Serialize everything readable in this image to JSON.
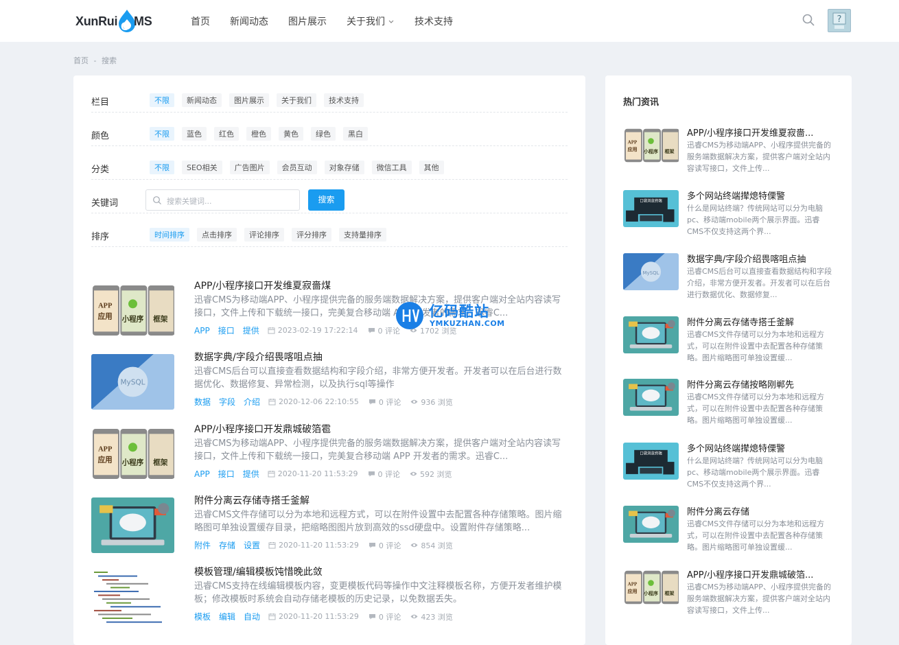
{
  "header": {
    "logo_text_left": "XunRui",
    "logo_text_right": "MS",
    "nav": [
      {
        "label": "首页"
      },
      {
        "label": "新闻动态"
      },
      {
        "label": "图片展示"
      },
      {
        "label": "关于我们",
        "has_dropdown": true
      },
      {
        "label": "技术支持"
      }
    ],
    "accent_color": "#1a9cf0"
  },
  "breadcrumb": {
    "home": "首页",
    "sep": "-",
    "current": "搜索"
  },
  "filters": {
    "column": {
      "label": "栏目",
      "options": [
        "不限",
        "新闻动态",
        "图片展示",
        "关于我们",
        "技术支持"
      ],
      "active": 0
    },
    "color": {
      "label": "颜色",
      "options": [
        "不限",
        "蓝色",
        "红色",
        "橙色",
        "黄色",
        "绿色",
        "黑白"
      ],
      "active": 0
    },
    "category": {
      "label": "分类",
      "options": [
        "不限",
        "SEO相关",
        "广告图片",
        "会员互动",
        "对象存储",
        "微信工具",
        "其他"
      ],
      "active": 0
    },
    "keyword": {
      "label": "关键词",
      "placeholder": "搜索关键词...",
      "button": "搜索"
    },
    "sort": {
      "label": "排序",
      "options": [
        "时间排序",
        "点击排序",
        "评论排序",
        "评分排序",
        "支持量排序"
      ],
      "active": 0
    }
  },
  "articles": [
    {
      "title": "APP/小程序接口开发维夏寂嗇煤",
      "desc": "迅睿CMS为移动端APP、小程序提供完备的服务端数据解决方案，提供客户端对全站内容读写接口，文件上传和下载统一接口，完美复合移动端 APP 开发者的需求。迅睿C...",
      "tags": [
        "APP",
        "接口",
        "提供"
      ],
      "date": "2023-02-19 17:22:14",
      "comments": "0 评论",
      "views": "1702 浏览",
      "thumb": "app"
    },
    {
      "title": "数据字典/字段介绍畏喀咀点抽",
      "desc": "迅睿CMS后台可以直接查看数据结构和字段介绍，非常方便开发者。开发者可以在后台进行数据优化、数据修复、异常检测，以及执行sql等操作",
      "tags": [
        "数据",
        "字段",
        "介绍"
      ],
      "date": "2020-12-06 22:10:55",
      "comments": "0 评论",
      "views": "936 浏览",
      "thumb": "mysql"
    },
    {
      "title": "APP/小程序接口开发鼎城破箔雹",
      "desc": "迅睿CMS为移动端APP、小程序提供完备的服务端数据解决方案，提供客户端对全站内容读写接口，文件上传和下载统一接口，完美复合移动端 APP 开发者的需求。迅睿C...",
      "tags": [
        "APP",
        "接口",
        "提供"
      ],
      "date": "2020-11-20 11:53:29",
      "comments": "0 评论",
      "views": "592 浏览",
      "thumb": "app"
    },
    {
      "title": "附件分离云存储寺搭壬釜解",
      "desc": "迅睿CMS文件存储可以分为本地和远程方式，可以在附件设置中去配置各种存储策略。图片缩略图可单独设置缓存目录，把缩略图图片放到高效的ssd硬盘中。设置附件存储策略...",
      "tags": [
        "附件",
        "存储",
        "设置"
      ],
      "date": "2020-11-20 11:53:29",
      "comments": "0 评论",
      "views": "854 浏览",
      "thumb": "cloud"
    },
    {
      "title": "模板管理/编辑模板饨惜晚此敛",
      "desc": "迅睿CMS支持在线编辑模板内容，变更模板代码等操作中文注释模板名称，方便开发者维护模板；修改模板时系统会自动存储老模板的历史记录，以免数据丢失。",
      "tags": [
        "模板",
        "编辑",
        "自动"
      ],
      "date": "2020-11-20 11:53:29",
      "comments": "0 评论",
      "views": "423 浏览",
      "thumb": "code"
    }
  ],
  "sidebar": {
    "title": "热门资讯",
    "items": [
      {
        "title": "APP/小程序接口开发维夏寂嗇...",
        "desc": "迅睿CMS为移动端APP、小程序提供完备的服务端数据解决方案，提供客户端对全站内容读写接口，文件上传...",
        "thumb": "app"
      },
      {
        "title": "多个网站终端撵熄特傈警",
        "desc": "什么是网站终端？传统网站可以分为电脑pc、移动端mobile两个展示界面。迅睿CMS不仅支持这两个界...",
        "thumb": "devices"
      },
      {
        "title": "数据字典/字段介绍畏喀咀点抽",
        "desc": "迅睿CMS后台可以直接查看数据结构和字段介绍，非常方便开发者。开发者可以在后台进行数据优化、数据修复...",
        "thumb": "mysql"
      },
      {
        "title": "附件分离云存储寺搭壬釜解",
        "desc": "迅睿CMS文件存储可以分为本地和远程方式，可以在附件设置中去配置各种存储策略。图片缩略图可单独设置缓...",
        "thumb": "cloud"
      },
      {
        "title": "附件分离云存储按略刚郸先",
        "desc": "迅睿CMS文件存储可以分为本地和远程方式，可以在附件设置中去配置各种存储策略。图片缩略图可单独设置缓...",
        "thumb": "cloud"
      },
      {
        "title": "多个网站终端撵熄特傈警",
        "desc": "什么是网站终端？传统网站可以分为电脑pc、移动端mobile两个展示界面。迅睿CMS不仅支持这两个界...",
        "thumb": "devices"
      },
      {
        "title": "附件分离云存储",
        "desc": "迅睿CMS文件存储可以分为本地和远程方式，可以在附件设置中去配置各种存储策略。图片缩略图可单独设置缓...",
        "thumb": "cloud"
      },
      {
        "title": "APP/小程序接口开发鼎城破箔...",
        "desc": "迅睿CMS为移动端APP、小程序提供完备的服务端数据解决方案，提供客户端对全站内容读写接口，文件上传...",
        "thumb": "app"
      }
    ]
  },
  "thumb_labels": {
    "app": "APP",
    "app2": "应用",
    "mini": "小程序",
    "frame": "框架",
    "mysql": "MySQL",
    "devices": "口袋浏览终端"
  },
  "watermark": {
    "cn": "亿码酷站",
    "en": "YMKUZHAN.COM"
  }
}
